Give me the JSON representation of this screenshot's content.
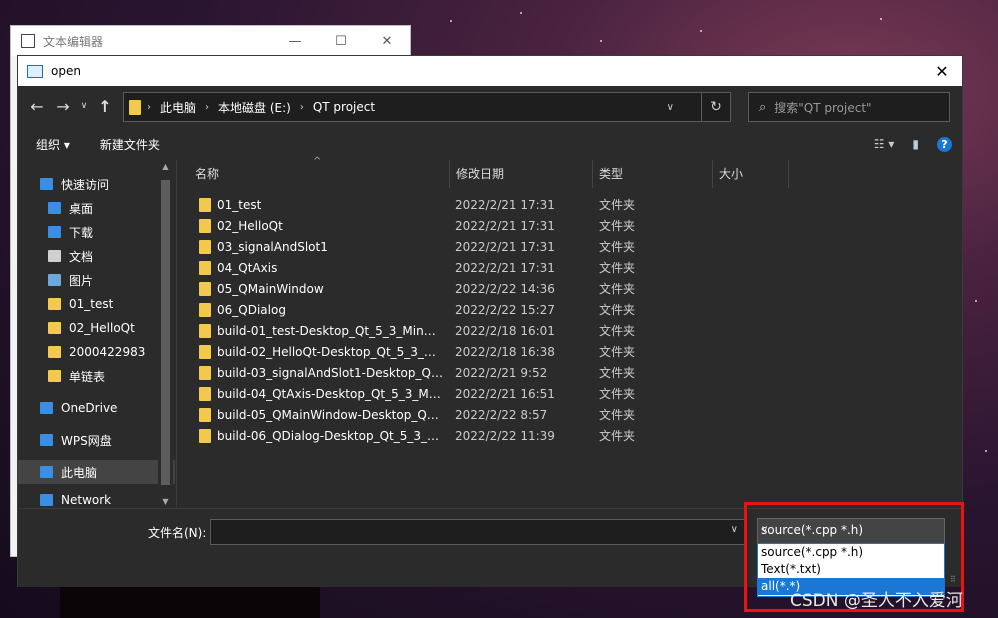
{
  "back_window": {
    "title": "文本编辑器",
    "min": "—",
    "max": "☐",
    "close": "✕"
  },
  "dialog": {
    "title": "open",
    "close": "✕",
    "nav": {
      "back": "←",
      "forward": "→",
      "recent": "∨",
      "up": "↑"
    },
    "address": {
      "crumbs": [
        "此电脑",
        "本地磁盘 (E:)",
        "QT project"
      ],
      "sep": "›",
      "dropdown": "∨",
      "refresh": "↻"
    },
    "search": {
      "placeholder": "搜索\"QT project\"",
      "icon": "⌕"
    },
    "toolbar": {
      "organize": "组织 ▾",
      "new_folder": "新建文件夹",
      "view": "☷ ▾",
      "preview": "▮",
      "help": "?"
    },
    "sidebar": [
      {
        "label": "快速访问",
        "icon": "star-icon",
        "color": "#3a8ee6",
        "pinned": false,
        "selected": false
      },
      {
        "label": "桌面",
        "icon": "desktop-icon",
        "color": "#3a8ee6",
        "pinned": true,
        "selected": false
      },
      {
        "label": "下载",
        "icon": "download-icon",
        "color": "#3a8ee6",
        "pinned": true,
        "selected": false
      },
      {
        "label": "文档",
        "icon": "document-icon",
        "color": "#d0d0d0",
        "pinned": true,
        "selected": false
      },
      {
        "label": "图片",
        "icon": "pictures-icon",
        "color": "#6fa8dc",
        "pinned": true,
        "selected": false
      },
      {
        "label": "01_test",
        "icon": "folder-icon",
        "color": "#f2c94c",
        "pinned": false,
        "selected": false
      },
      {
        "label": "02_HelloQt",
        "icon": "folder-icon",
        "color": "#f2c94c",
        "pinned": false,
        "selected": false
      },
      {
        "label": "2000422983",
        "icon": "folder-icon",
        "color": "#f2c94c",
        "pinned": false,
        "selected": false
      },
      {
        "label": "单链表",
        "icon": "folder-icon",
        "color": "#f2c94c",
        "pinned": false,
        "selected": false
      },
      {
        "label": "OneDrive",
        "icon": "cloud-icon",
        "color": "#3a8ee6",
        "pinned": false,
        "selected": false
      },
      {
        "label": "WPS网盘",
        "icon": "cloud-icon",
        "color": "#3a8ee6",
        "pinned": false,
        "selected": false
      },
      {
        "label": "此电脑",
        "icon": "computer-icon",
        "color": "#3a8ee6",
        "pinned": false,
        "selected": true
      },
      {
        "label": "Network",
        "icon": "network-icon",
        "color": "#3a8ee6",
        "pinned": false,
        "selected": false
      }
    ],
    "pin_glyph": "📌",
    "columns": {
      "name": "名称",
      "date": "修改日期",
      "type": "类型",
      "size": "大小",
      "sort": "^"
    },
    "files": [
      {
        "name": "01_test",
        "date": "2022/2/21 17:31",
        "type": "文件夹"
      },
      {
        "name": "02_HelloQt",
        "date": "2022/2/21 17:31",
        "type": "文件夹"
      },
      {
        "name": "03_signalAndSlot1",
        "date": "2022/2/21 17:31",
        "type": "文件夹"
      },
      {
        "name": "04_QtAxis",
        "date": "2022/2/21 17:31",
        "type": "文件夹"
      },
      {
        "name": "05_QMainWindow",
        "date": "2022/2/22 14:36",
        "type": "文件夹"
      },
      {
        "name": "06_QDialog",
        "date": "2022/2/22 15:27",
        "type": "文件夹"
      },
      {
        "name": "build-01_test-Desktop_Qt_5_3_MinG...",
        "date": "2022/2/18 16:01",
        "type": "文件夹"
      },
      {
        "name": "build-02_HelloQt-Desktop_Qt_5_3_Mi...",
        "date": "2022/2/18 16:38",
        "type": "文件夹"
      },
      {
        "name": "build-03_signalAndSlot1-Desktop_Qt_...",
        "date": "2022/2/21 9:52",
        "type": "文件夹"
      },
      {
        "name": "build-04_QtAxis-Desktop_Qt_5_3_Min...",
        "date": "2022/2/21 16:51",
        "type": "文件夹"
      },
      {
        "name": "build-05_QMainWindow-Desktop_Qt_...",
        "date": "2022/2/22 8:57",
        "type": "文件夹"
      },
      {
        "name": "build-06_QDialog-Desktop_Qt_5_3_M...",
        "date": "2022/2/22 11:39",
        "type": "文件夹"
      }
    ],
    "filename_label": "文件名(N):",
    "filename_value": "",
    "filter": {
      "selected": "source(*.cpp *.h)",
      "dropdown": "∨",
      "options": [
        "source(*.cpp *.h)",
        "Text(*.txt)",
        "all(*.*)"
      ],
      "highlighted_index": 2
    }
  },
  "watermark": "CSDN @圣人不入爱河",
  "colors": {
    "accent": "#1a78d4",
    "folder": "#f2c94c",
    "highlight_box": "#e11111"
  }
}
